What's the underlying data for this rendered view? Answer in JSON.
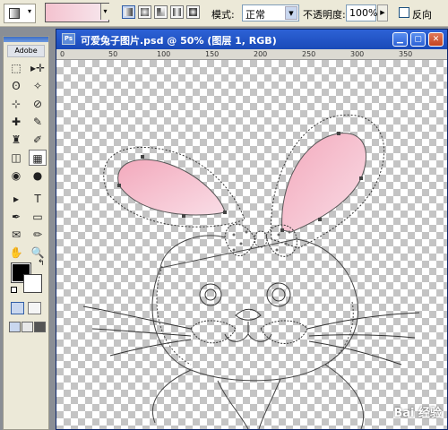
{
  "options_bar": {
    "mode_label": "模式:",
    "mode_value": "正常",
    "opacity_label": "不透明度:",
    "opacity_value": "100%",
    "reverse_label": "反向"
  },
  "document": {
    "title": "可爱兔子图片.psd @ 50% (图层 1, RGB)",
    "ps_icon_text": "Ps",
    "ruler_ticks": [
      "0",
      "50",
      "100",
      "150",
      "200",
      "250",
      "300",
      "350"
    ]
  },
  "toolbox": {
    "logo_text": "Adobe",
    "tools": [
      "marquee-icon",
      "move-icon",
      "lasso-icon",
      "magic-wand-icon",
      "crop-icon",
      "slice-icon",
      "healing-icon",
      "brush-icon",
      "stamp-icon",
      "history-brush-icon",
      "eraser-icon",
      "gradient-icon",
      "blur-icon",
      "dodge-icon",
      "path-select-icon",
      "type-icon",
      "pen-icon",
      "shape-icon",
      "notes-icon",
      "eyedropper-icon",
      "hand-icon",
      "zoom-icon"
    ],
    "tool_glyphs": [
      "⬚",
      "▸✛",
      "ʘ",
      "✧",
      "⊹",
      "⊘",
      "✚",
      "✎",
      "♜",
      "✐",
      "◫",
      "▦",
      "◉",
      "●",
      "▸",
      "T",
      "✒",
      "▭",
      "✉",
      "✏",
      "✋",
      "🔍"
    ]
  },
  "colors": {
    "foreground": "#000000",
    "background": "#ffffff",
    "gradient_start": "#f4c2cf",
    "gradient_end": "#f7e8ee",
    "ear_fill": "#f3b4c4"
  },
  "watermark": "Bai 经验"
}
